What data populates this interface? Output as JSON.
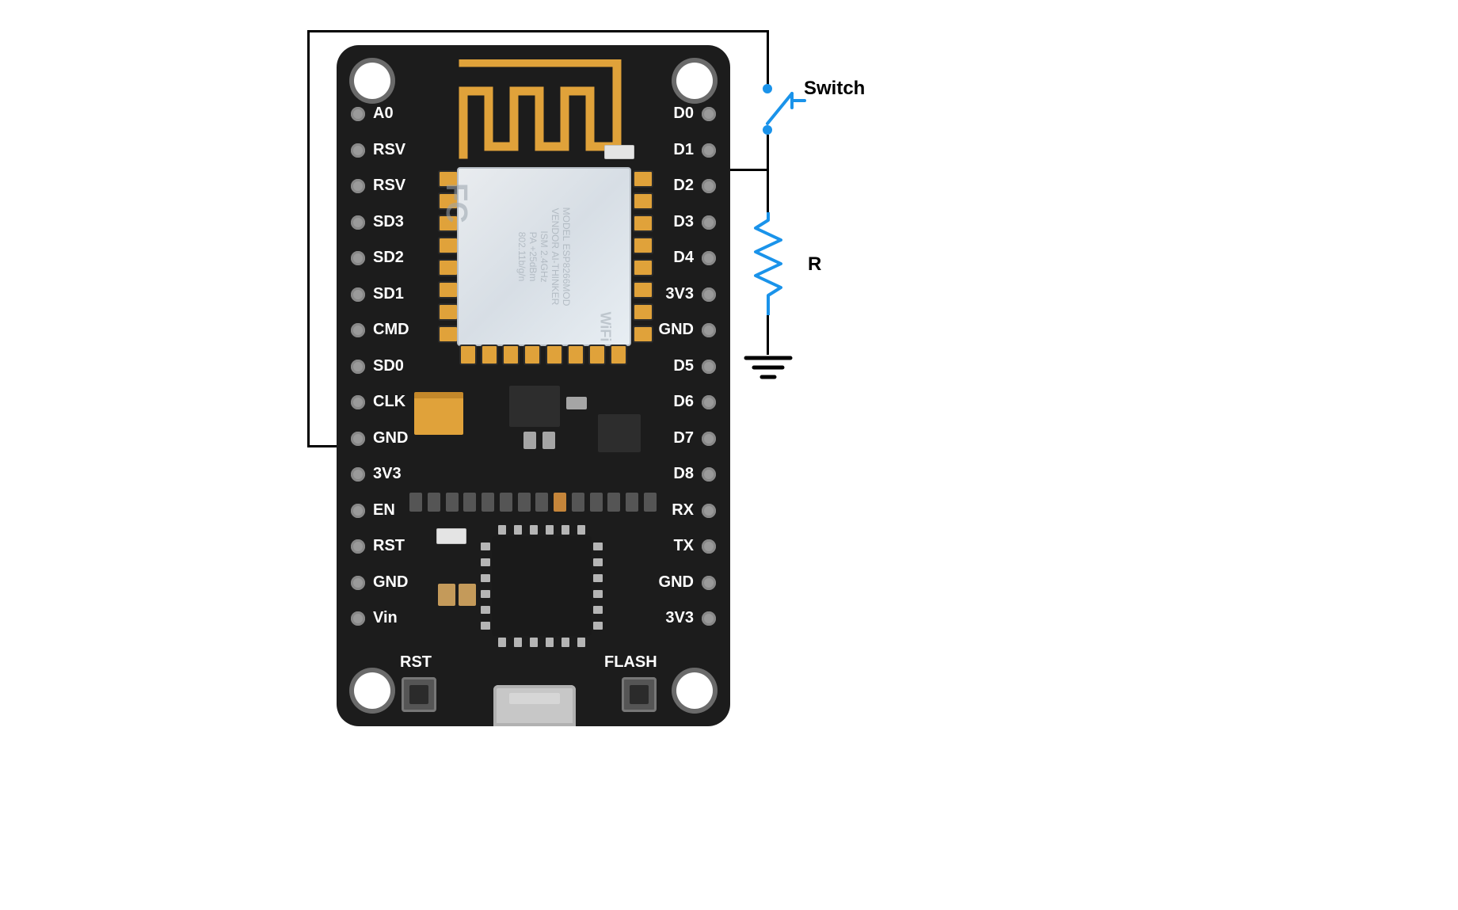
{
  "board": {
    "module": {
      "chip_name": "ESP8266MOD",
      "vendor": "AI-THINKER",
      "radio": "ISM 2.4GHz",
      "power": "PA +25dBm",
      "standard": "802.11b/g/n",
      "fcc_mark": "FC",
      "model_label": "MODEL",
      "vendor_label": "VENDOR",
      "wifi_label": "WiFi"
    },
    "pins_left": [
      "A0",
      "RSV",
      "RSV",
      "SD3",
      "SD2",
      "SD1",
      "CMD",
      "SD0",
      "CLK",
      "GND",
      "3V3",
      "EN",
      "RST",
      "GND",
      "Vin"
    ],
    "pins_right": [
      "D0",
      "D1",
      "D2",
      "D3",
      "D4",
      "3V3",
      "GND",
      "D5",
      "D6",
      "D7",
      "D8",
      "RX",
      "TX",
      "GND",
      "3V3"
    ],
    "button_rst": "RST",
    "button_flash": "FLASH"
  },
  "circuit": {
    "switch_label": "Switch",
    "resistor_label": "R",
    "connections": {
      "power_from_pin": "3V3",
      "signal_to_pin": "D2",
      "resistor_to": "GND"
    }
  }
}
